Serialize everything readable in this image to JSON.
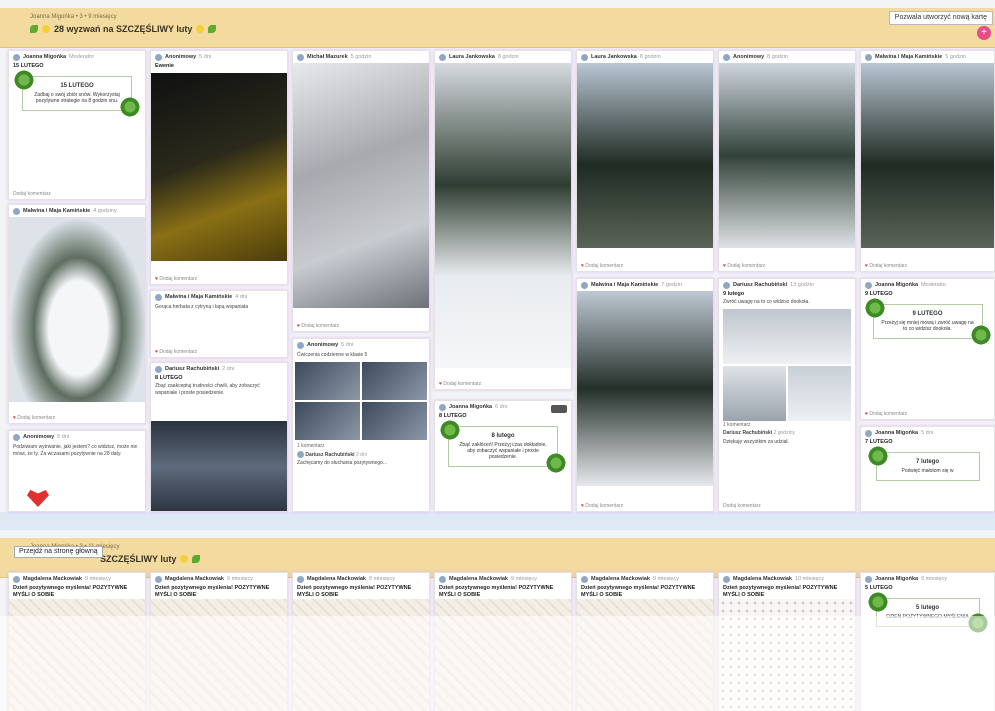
{
  "board1": {
    "meta": "Joanna Migońka • 3 • 9 miesięcy",
    "title": "28 wyzwań na SZCZĘŚLIWY luty",
    "new_card_button": "Pozwala utworzyć nową kartę",
    "columns": [
      {
        "cards": [
          {
            "author": "Joanna Migońka",
            "time": "Moderator",
            "title": "15 LUTEGO",
            "frame_title": "15 LUTEGO",
            "frame_text": "Zadbaj o swój zbiór snów. Wykorzystaj pozytywne strategie na 8 godzin snu.",
            "footer": "Dodaj komentarz"
          },
          {
            "author": "Malwina i Maja Kamińskie",
            "time": "4 godziny",
            "footer": "Dodaj komentarz"
          },
          {
            "author": "Anonimowy",
            "time": "5 dni",
            "text": "Podziwiam wytrwanie, jaki jestem? co widzisz, może nie mówi, że ty. Za wczasami pozytywnie na 28 daty.",
            "footer": ""
          }
        ]
      },
      {
        "cards": [
          {
            "author": "Anonimowy",
            "time": "5 dni",
            "title": "Ewenie",
            "footer": "Dodaj komentarz"
          },
          {
            "author": "Malwina i Maja Kamińskie",
            "time": "4 dni",
            "text": "Gorąca herbata z cytryną i łapą wspaniała",
            "footer": "Dodaj komentarz"
          },
          {
            "author": "Dariusz Rachubiński",
            "time": "2 dni",
            "title": "8 LUTEGO",
            "text": "Zbąć zaakceptuj trudności chwili, aby zobaczyć wspaniałe i proste posiedzenie.",
            "footer": ""
          }
        ]
      },
      {
        "cards": [
          {
            "author": "Michał Mazurek",
            "time": "5 godzin",
            "footer": "Dodaj komentarz"
          },
          {
            "author": "Anonimowy",
            "time": "5 dni",
            "text": "Ćwiczenia codzienne w klasie 5",
            "comments": "1 komentarz",
            "comment_author": "Dariusz Rachubiński",
            "comment_time": "2 dni",
            "comment_text": "Zachęcamy do słuchania pozytywnego..."
          }
        ]
      },
      {
        "cards": [
          {
            "author": "Laura Jankowska",
            "time": "8 godzin",
            "footer": "Dodaj komentarz"
          },
          {
            "author": "Joanna Migońka",
            "time": "6 dni",
            "title": "8 LUTEGO",
            "frame_title": "8 lutego",
            "frame_text": "Zbąć zakłóceń! Przeżyj czas dokładnie, aby zobaczyć wspaniałe i proste posiedzenie."
          }
        ]
      },
      {
        "cards": [
          {
            "author": "Laura Jankowska",
            "time": "8 godzin",
            "footer": "Dodaj komentarz"
          },
          {
            "author": "Malwina i Maja Kamińskie",
            "time": "7 godzin",
            "footer": "Dodaj komentarz"
          }
        ]
      },
      {
        "cards": [
          {
            "author": "Anonimowy",
            "time": "8 godzin",
            "footer": "Dodaj komentarz"
          },
          {
            "author": "Dariusz Rachubiński",
            "time": "13 godzin",
            "title": "9 lutego",
            "text": "Zwróć uwagę na to co widzisz dookoła.",
            "comments": "1 komentarz",
            "comment_author": "Dariusz Rachubiński",
            "comment_time": "2 godziny",
            "comment_text": "Dziękuję wszystkim za udział.",
            "footer": "Dodaj komentarz"
          }
        ]
      },
      {
        "cards": [
          {
            "author": "Malwina i Maja Kamińskie",
            "time": "5 godzin",
            "footer": "Dodaj komentarz"
          },
          {
            "author": "Joanna Migońka",
            "time": "Moderator",
            "title": "9 LUTEGO",
            "frame_title": "9 LUTEGO",
            "frame_text": "Przeżyj się mniej mową i zwróć uwagę na to co widzisz dookoła.",
            "footer": "Dodaj komentarz"
          },
          {
            "author": "Joanna Migońka",
            "time": "5 dni",
            "title": "7 LUTEGO",
            "frame_title": "7 lutego",
            "frame_text": "Poświęć małotom się w"
          }
        ]
      }
    ]
  },
  "board2": {
    "meta": "Joanna Migońka • 3 • 11 miesięcy",
    "tooltip": "Przejdź na stronę główną",
    "title": "SZCZĘŚLIWY luty",
    "columns": [
      {
        "author": "Magdalena Maćkowiak",
        "time": "9 miesięcy",
        "title": "Dzień pozytywnego myślenia! POZYTYWNE MYŚLI O SOBIE"
      },
      {
        "author": "Magdalena Maćkowiak",
        "time": "9 miesięcy",
        "title": "Dzień pozytywnego myślenia! POZYTYWNE MYŚLI O SOBIE"
      },
      {
        "author": "Magdalena Maćkowiak",
        "time": "9 miesięcy",
        "title": "Dzień pozytywnego myślenia! POZYTYWNE MYŚLI O SOBIE"
      },
      {
        "author": "Magdalena Maćkowiak",
        "time": "9 miesięcy",
        "title": "Dzień pozytywnego myślenia! POZYTYWNE MYŚLI O SOBIE"
      },
      {
        "author": "Magdalena Maćkowiak",
        "time": "9 miesięcy",
        "title": "Dzień pozytywnego myślenia! POZYTYWNE MYŚLI O SOBIE"
      },
      {
        "author": "Magdalena Maćkowiak",
        "time": "10 miesięcy",
        "title": "Dzień pozytywnego myślenia! POZYTYWNE MYŚLI O SOBIE"
      },
      {
        "author": "Joanna Migońka",
        "time": "9 miesięcy",
        "title": "5 LUTEGO",
        "frame_title": "5 lutego",
        "frame_text": "DZIEŃ POZYTYWNEGO MYŚLENIA"
      }
    ]
  },
  "colors": {
    "header": "#f3dba0",
    "accent": "#e84d8a",
    "heart": "#d23a3a"
  }
}
